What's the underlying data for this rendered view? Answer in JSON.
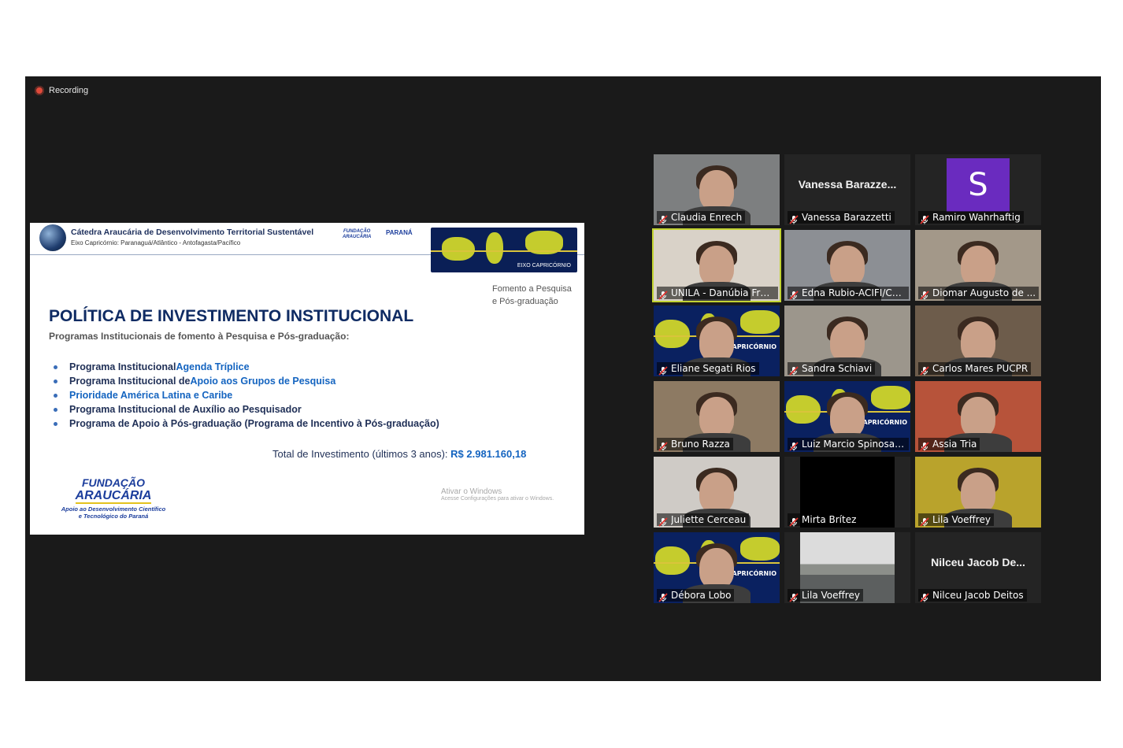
{
  "recording": {
    "label": "Recording"
  },
  "slide": {
    "header_title": "Cátedra Araucária de Desenvolvimento Territorial Sustentável",
    "header_sub": "Eixo Capricórnio: Paranaguá/Atlântico - Antofagasta/Pacífico",
    "logo_small_1a": "FUNDAÇÃO",
    "logo_small_1b": "ARAUCÁRIA",
    "logo_small_2": "PARANÁ",
    "banner_label": "EIXO CAPRICÓRNIO",
    "fomento_1": "Fomento a Pesquisa",
    "fomento_2": "e Pós-graduação",
    "title": "POLÍTICA DE INVESTIMENTO INSTITUCIONAL",
    "subtitle": "Programas Institucionais de fomento à Pesquisa e Pós-graduação:",
    "bullets": [
      {
        "pre": "Programa Institucional ",
        "hl": "Agenda Tríplice",
        "post": ""
      },
      {
        "pre": "Programa Institucional de ",
        "hl": "Apoio aos Grupos de Pesquisa",
        "post": ""
      },
      {
        "pre": "",
        "hl": "Prioridade América Latina e Caribe",
        "post": ""
      },
      {
        "pre": "Programa Institucional de Auxílio ao Pesquisador",
        "hl": "",
        "post": ""
      },
      {
        "pre": "Programa de Apoio à Pós-graduação (Programa de Incentivo à Pós-graduação)",
        "hl": "",
        "post": ""
      }
    ],
    "total_label": "Total de Investimento (últimos 3 anos): ",
    "total_value": "R$ 2.981.160,18",
    "fa_line1": "FUNDAÇÃO",
    "fa_line2": "ARAUCÁRIA",
    "fa_line3": "Apoio ao Desenvolvimento Científico",
    "fa_line4": "e Tecnológico do Paraná",
    "ativar_1": "Ativar o Windows",
    "ativar_2": "Acesse Configurações para ativar o Windows."
  },
  "participants": [
    {
      "name": "Claudia Enrech",
      "type": "video",
      "tone": "#7d7f80"
    },
    {
      "name": "Vanessa Barazzetti",
      "type": "name",
      "display": "Vanessa  Barazze..."
    },
    {
      "name": "Ramiro Wahrhaftig",
      "type": "avatar",
      "letter": "S"
    },
    {
      "name": "UNILA - Danúbia Frasso...",
      "type": "video",
      "tone": "#d9d2c8",
      "active": true
    },
    {
      "name": "Edna Rubio-ACIFI/CO...",
      "type": "video",
      "tone": "#8c8f94"
    },
    {
      "name": "Diomar Augusto de ...",
      "type": "video",
      "tone": "#a39889"
    },
    {
      "name": "Eliane Segati Rios",
      "type": "map"
    },
    {
      "name": "Sandra Schiavi",
      "type": "video",
      "tone": "#9c968c"
    },
    {
      "name": "Carlos Mares PUCPR",
      "type": "video",
      "tone": "#6d5c4b"
    },
    {
      "name": "Bruno Razza",
      "type": "video",
      "tone": "#8d7a63"
    },
    {
      "name": "Luiz Marcio Spinosa ...",
      "type": "map"
    },
    {
      "name": "Assia Tria",
      "type": "video",
      "tone": "#b7533a"
    },
    {
      "name": "Juliette Cerceau",
      "type": "video",
      "tone": "#cfcbc6"
    },
    {
      "name": "Mirta Brítez",
      "type": "black"
    },
    {
      "name": "Lila Voeffrey",
      "type": "video",
      "tone": "#b9a32c"
    },
    {
      "name": "Débora Lobo",
      "type": "map"
    },
    {
      "name": "Lila Voeffrey",
      "type": "landscape"
    },
    {
      "name": "Nilceu Jacob Deitos",
      "type": "name",
      "display": "Nilceu  Jacob  De..."
    }
  ]
}
